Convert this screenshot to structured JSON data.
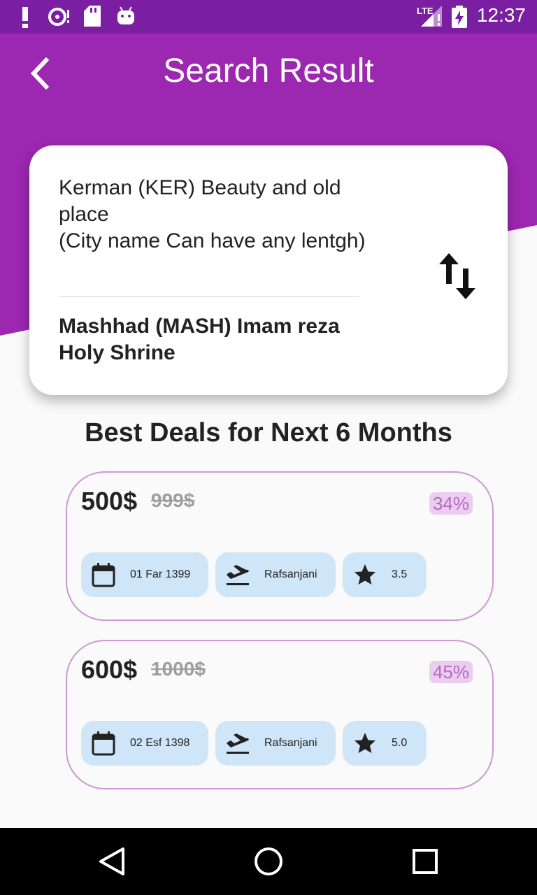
{
  "status_bar": {
    "time": "12:37",
    "network": "LTE",
    "icons": [
      "alert-icon",
      "media-icon",
      "sd-card-icon",
      "android-icon",
      "signal-icon",
      "battery-charging-icon"
    ]
  },
  "header": {
    "title": "Search Result",
    "back_icon": "chevron-left-icon"
  },
  "route": {
    "origin": "Kerman (KER) Beauty and old place\n(City name Can have any lentgh)",
    "destination": "Mashhad (MASH) Imam reza Holy Shrine",
    "swap_icon": "swap-vertical-icon"
  },
  "deals_title": "Best Deals for Next 6 Months",
  "deals": [
    {
      "price": "500$",
      "old_price": "999$",
      "discount": "34%",
      "date": "01 Far 1399",
      "airport": "Rafsanjani",
      "rating": "3.5"
    },
    {
      "price": "600$",
      "old_price": "1000$",
      "discount": "45%",
      "date": "02 Esf 1398",
      "airport": "Rafsanjani",
      "rating": "5.0"
    }
  ],
  "colors": {
    "status_bar": "#7b1fa2",
    "primary": "#9c27b0",
    "card_border": "#cf98d6",
    "chip_bg": "#cfe6f8",
    "discount_bg": "#ebcdef",
    "discount_text": "#b56bc2"
  },
  "nav_bar": {
    "icons": [
      "back-triangle-icon",
      "home-circle-icon",
      "recents-square-icon"
    ]
  }
}
